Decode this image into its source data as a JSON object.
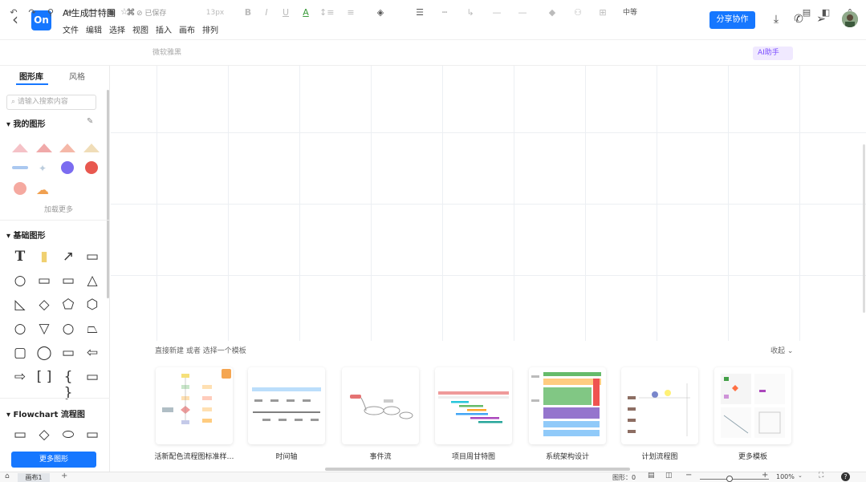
{
  "titlebar": {
    "title": "AI生成甘特图",
    "saved": "已保存",
    "logo": "On",
    "share": "分享协作",
    "menu": [
      "文件",
      "编辑",
      "选择",
      "视图",
      "插入",
      "画布",
      "排列"
    ]
  },
  "toolbar": {
    "font": "微软雅黑",
    "font_size": "13px",
    "middle": "中等",
    "ai": "AI助手"
  },
  "left": {
    "tabs": [
      "图形库",
      "风格"
    ],
    "search_placeholder": "请输入搜索内容",
    "my_shapes": "我的图形",
    "load_more": "加载更多",
    "basic": "基础图形",
    "flowchart": "Flowchart 流程图",
    "more_shapes": "更多图形"
  },
  "templates": {
    "header": "直接新建 或者 选择一个模板",
    "collapse": "收起",
    "items": [
      {
        "label": "活新配色流程图标准样…"
      },
      {
        "label": "时间轴"
      },
      {
        "label": "事件流"
      },
      {
        "label": "项目周甘特图"
      },
      {
        "label": "系统架构设计"
      },
      {
        "label": "计划流程图"
      },
      {
        "label": "更多模板"
      }
    ]
  },
  "status": {
    "page": "画布1",
    "shapes": "图形：0",
    "zoom": "100%"
  },
  "colors": {
    "accent": "#1677ff"
  }
}
